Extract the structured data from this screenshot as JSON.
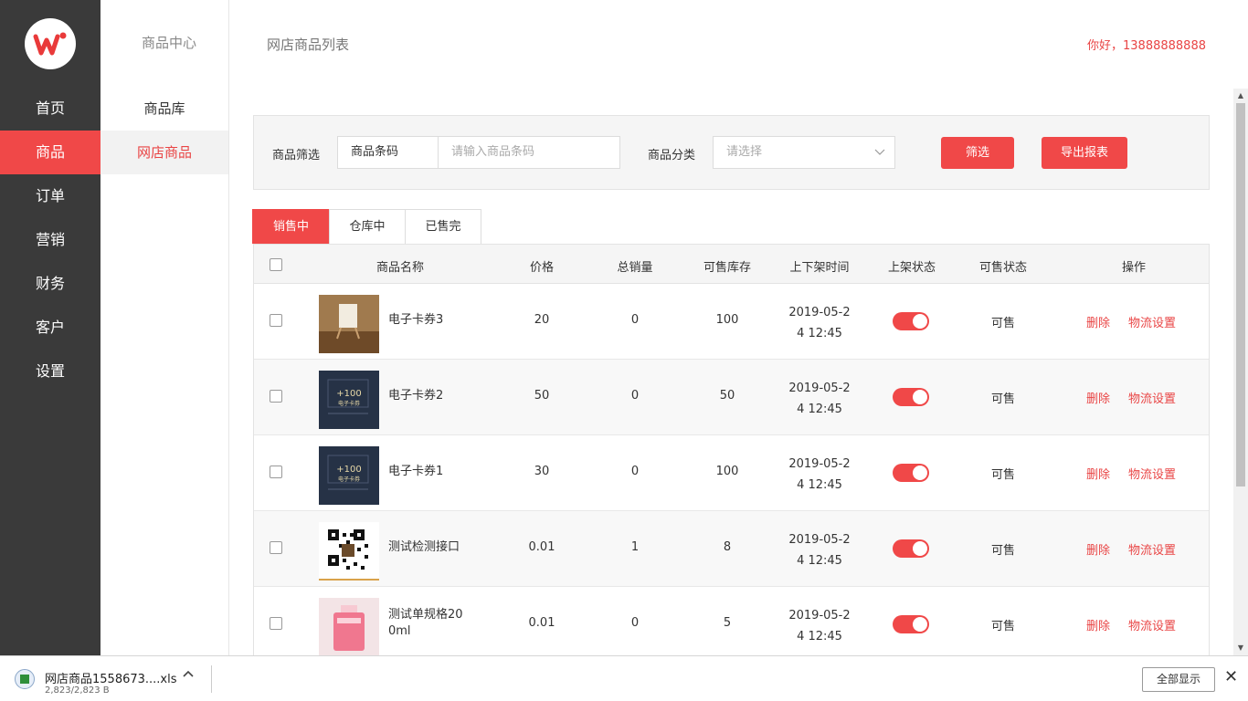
{
  "nav_main": {
    "items": [
      "首页",
      "商品",
      "订单",
      "营销",
      "财务",
      "客户",
      "设置"
    ],
    "active_index": 1
  },
  "nav_sub": {
    "title": "商品中心",
    "items": [
      "商品库",
      "网店商品"
    ],
    "active_index": 1
  },
  "header": {
    "title": "网店商品列表",
    "greeting": "你好，13888888888"
  },
  "filter": {
    "label": "商品筛选",
    "type_value": "商品条码",
    "barcode_placeholder": "请输入商品条码",
    "category_label": "商品分类",
    "category_placeholder": "请选择",
    "filter_button": "筛选",
    "export_button": "导出报表"
  },
  "tabs": [
    "销售中",
    "仓库中",
    "已售完"
  ],
  "table": {
    "columns": [
      "商品名称",
      "价格",
      "总销量",
      "可售库存",
      "上下架时间",
      "上架状态",
      "可售状态",
      "操作"
    ],
    "rows": [
      {
        "name": "电子卡券3",
        "price": "20",
        "sales": "0",
        "stock": "100",
        "time1": "2019-05-2",
        "time2": "4 12:45",
        "status": "可售",
        "thumb": "easel"
      },
      {
        "name": "电子卡券2",
        "price": "50",
        "sales": "0",
        "stock": "50",
        "time1": "2019-05-2",
        "time2": "4 12:45",
        "status": "可售",
        "thumb": "coupon"
      },
      {
        "name": "电子卡券1",
        "price": "30",
        "sales": "0",
        "stock": "100",
        "time1": "2019-05-2",
        "time2": "4 12:45",
        "status": "可售",
        "thumb": "coupon"
      },
      {
        "name": "测试检测接口",
        "price": "0.01",
        "sales": "1",
        "stock": "8",
        "time1": "2019-05-2",
        "time2": "4 12:45",
        "status": "可售",
        "thumb": "qrcode"
      },
      {
        "name": "测试单规格20",
        "name2": "0ml",
        "price": "0.01",
        "sales": "0",
        "stock": "5",
        "time1": "2019-05-2",
        "time2": "4 12:45",
        "status": "可售",
        "thumb": "perfume"
      }
    ],
    "coupon_text1": "+100",
    "coupon_text2": "电子卡券",
    "delete_label": "删除",
    "logistics_label": "物流设置"
  },
  "download": {
    "file_name": "网店商品1558673....xls",
    "size": "2,823/2,823 B",
    "show_all": "全部显示"
  },
  "colors": {
    "accent": "#f04848",
    "nav_bg": "#3a3a3a"
  }
}
